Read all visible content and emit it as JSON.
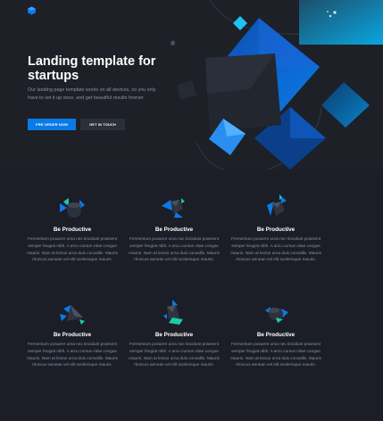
{
  "hero": {
    "title": "Landing template for startups",
    "description": "Our landing page template works on all devices, so you only have to set it up once, and get beautiful results forever.",
    "primary_button": "PRE ORDER NOW",
    "secondary_button": "GET IN TOUCH"
  },
  "features": [
    {
      "title": "Be Productive",
      "text": "Fermentum posuere urna nec tincidunt praesent semper feugiat nibh. A arcu cursus vitae congue mauris. Nam at lectus urna duis convallis. Mauris rhoncus aenean vel elit scelerisque mauris.",
      "icon": "cube-icon"
    },
    {
      "title": "Be Productive",
      "text": "Fermentum posuere urna nec tincidunt praesent semper feugiat nibh. A arcu cursus vitae congue mauris. Nam at lectus urna duis convallis. Mauris rhoncus aenean vel elit scelerisque mauris.",
      "icon": "cube-icon"
    },
    {
      "title": "Be Productive",
      "text": "Fermentum posuere urna nec tincidunt praesent semper feugiat nibh. A arcu cursus vitae congue mauris. Nam at lectus urna duis convallis. Mauris rhoncus aenean vel elit scelerisque mauris.",
      "icon": "cube-icon"
    },
    {
      "title": "Be Productive",
      "text": "Fermentum posuere urna nec tincidunt praesent semper feugiat nibh. A arcu cursus vitae congue mauris. Nam at lectus urna duis convallis. Mauris rhoncus aenean vel elit scelerisque mauris.",
      "icon": "pyramid-icon"
    },
    {
      "title": "Be Productive",
      "text": "Fermentum posuere urna nec tincidunt praesent semper feugiat nibh. A arcu cursus vitae congue mauris. Nam at lectus urna duis convallis. Mauris rhoncus aenean vel elit scelerisque mauris.",
      "icon": "pyramid-icon"
    },
    {
      "title": "Be Productive",
      "text": "Fermentum posuere urna nec tincidunt praesent semper feugiat nibh. A arcu cursus vitae congue mauris. Nam at lectus urna duis convallis. Mauris rhoncus aenean vel elit scelerisque mauris.",
      "icon": "cylinder-icon"
    }
  ],
  "colors": {
    "background": "#1b1e26",
    "accent": "#0a7ae8",
    "teal": "#1fc8a8",
    "text_muted": "#8a93a8"
  }
}
